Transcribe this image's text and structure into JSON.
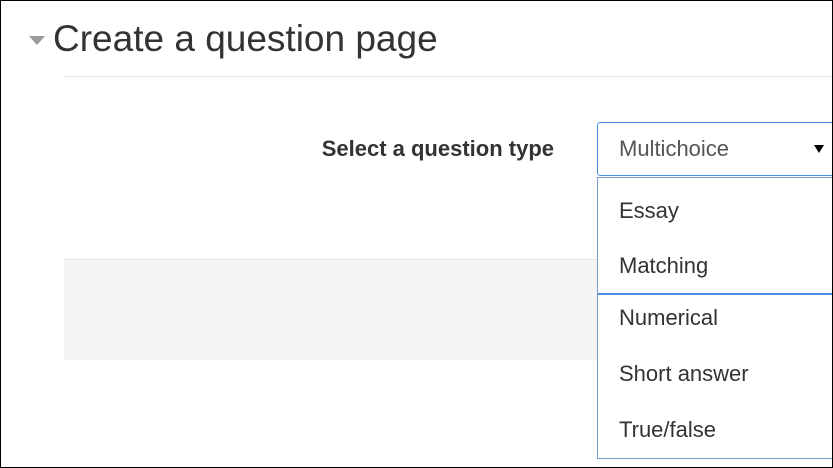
{
  "section": {
    "title": "Create a question page",
    "toggle_icon": "chevron-down-icon"
  },
  "form": {
    "label": "Select a question type",
    "select": {
      "selected": "Multichoice"
    },
    "dropdown": {
      "options": [
        "Essay",
        "Matching",
        "Numerical",
        "Short answer",
        "True/false"
      ]
    }
  },
  "colors": {
    "focus_border": "#4a90e2",
    "text": "#333333",
    "band_background": "#f5f5f5"
  }
}
